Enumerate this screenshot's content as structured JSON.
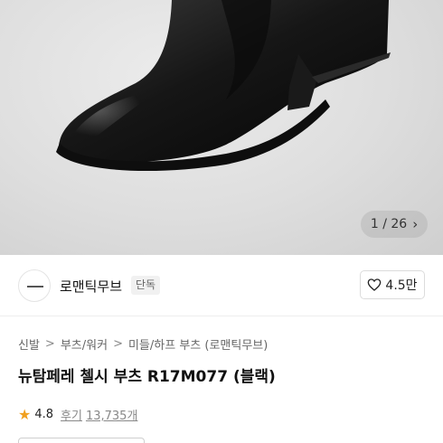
{
  "gallery": {
    "current": "1",
    "separator": "/",
    "total": "26",
    "next_icon": "chevron-right-icon",
    "background": "#dcdcdc"
  },
  "brand": {
    "name": "로맨틱무브",
    "badge": "단독",
    "like_icon": "heart-icon",
    "like_count": "4.5만"
  },
  "breadcrumb": {
    "items": [
      "신발",
      "부츠/워커",
      "미들/하프 부츠 (로맨틱무브)"
    ],
    "separator": ">"
  },
  "product": {
    "title": "뉴탐페레 첼시 부츠 R17M077 (블랙)"
  },
  "rating": {
    "star_icon": "star-icon",
    "score": "4.8",
    "review_label": "후기",
    "review_count": "13,735개",
    "star_color": "#f0a020"
  }
}
